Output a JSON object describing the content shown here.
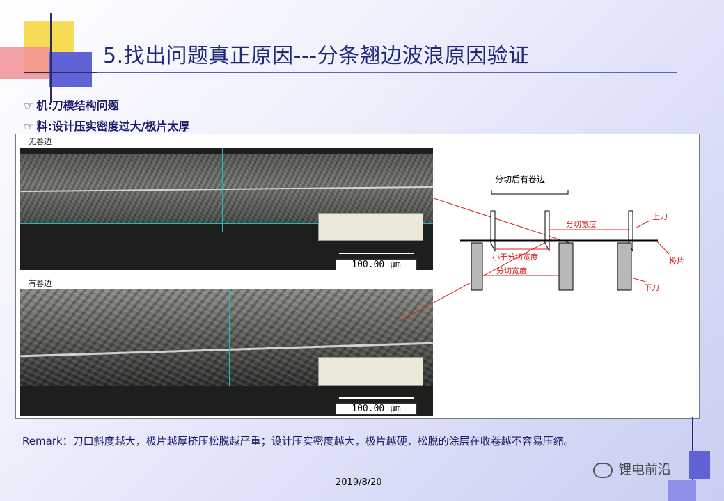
{
  "slide": {
    "title": "5.找出问题真正原因---分条翘边波浪原因验证",
    "bullets": [
      {
        "mark": "☞",
        "text": "机:刀模结构问题"
      },
      {
        "mark": "☞",
        "text": "料:设计压实密度过大/极片太厚"
      }
    ],
    "remark": "Remark：刀口斜度越大，极片越厚挤压松脱越严重；设计压实密度越大，极片越硬，松脱的涂层在收卷越不容易压缩。",
    "date": "2019/8/20",
    "watermark": "锂电前沿"
  },
  "figure": {
    "photo1_label": "无卷边",
    "photo2_label": "有卷边",
    "scale_text": "100.00 μm",
    "diagram": {
      "heading": "分切后有卷边",
      "label_width": "分切宽度",
      "label_upper_blade": "上刀",
      "label_sheet": "极片",
      "label_less": "小于分切宽度",
      "label_width2": "分切宽度",
      "label_lower_blade": "下刀"
    }
  },
  "colors": {
    "title": "#1f2a7a",
    "accent_blue": "#5f63d6",
    "accent_yellow": "#f6dc55",
    "accent_pink": "#ef8f95",
    "annotation_red": "#d42020"
  }
}
